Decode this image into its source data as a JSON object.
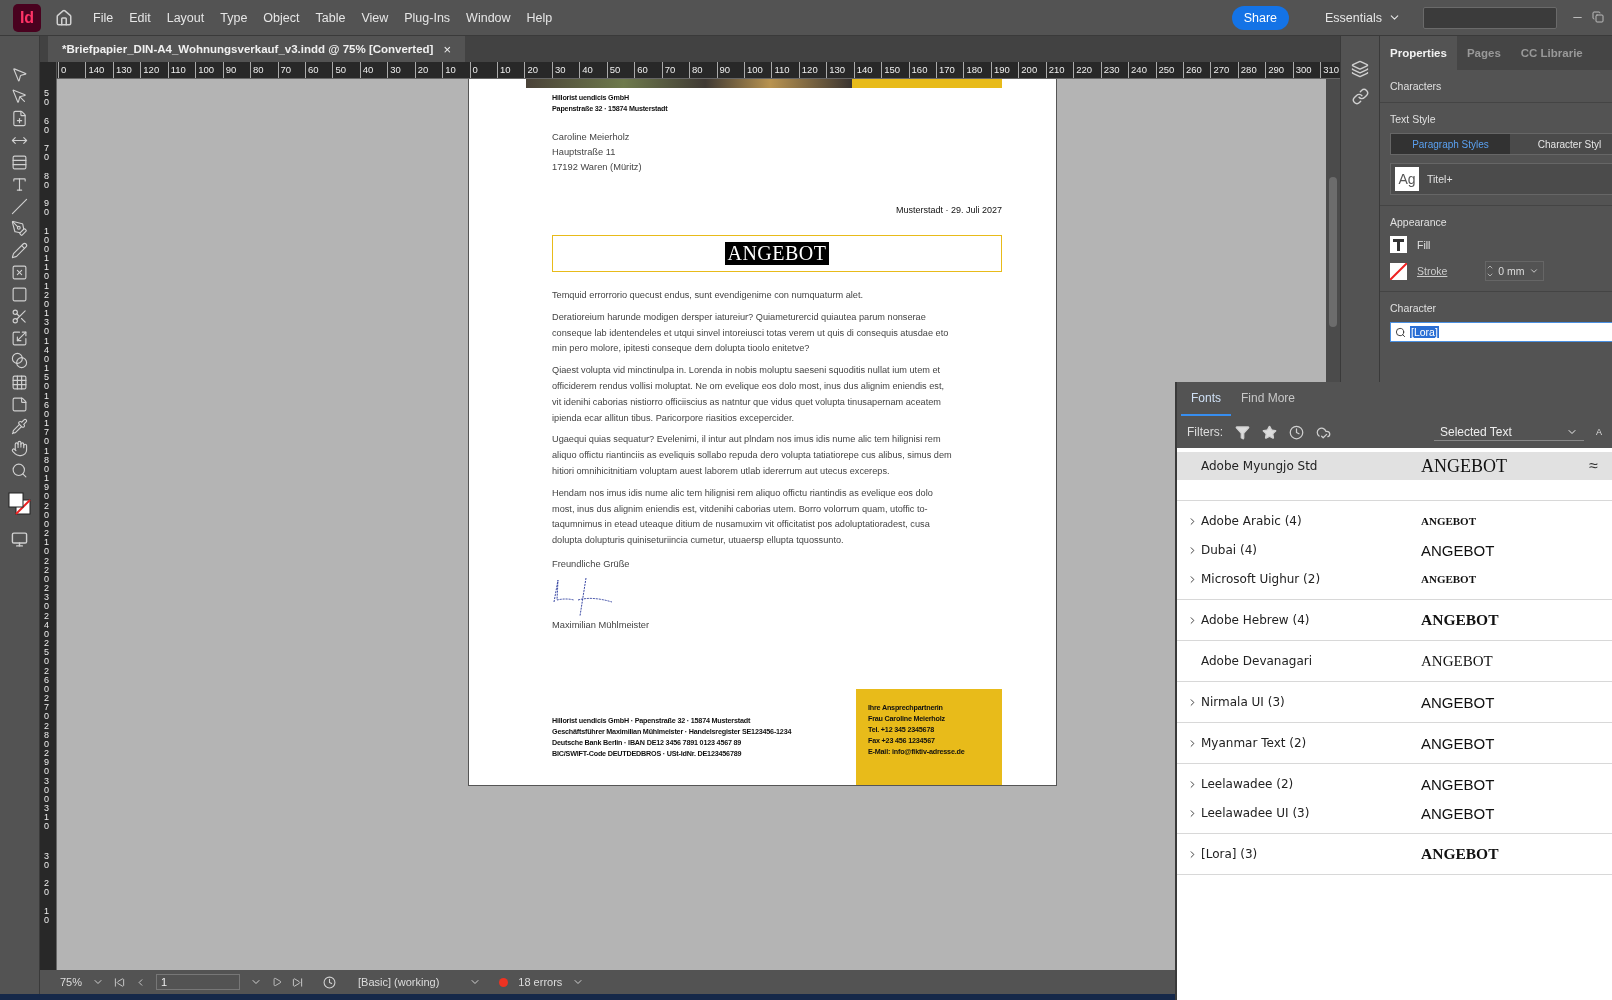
{
  "app": {
    "logo": "Id",
    "menu": [
      "File",
      "Edit",
      "Layout",
      "Type",
      "Object",
      "Table",
      "View",
      "Plug-Ins",
      "Window",
      "Help"
    ],
    "share": "Share",
    "workspace": "Essentials"
  },
  "document_tab": {
    "title": "*Briefpapier_DIN-A4_Wohnungsverkauf_v3.indd @ 75% [Converted]",
    "close": "×"
  },
  "ruler": {
    "horizontal": [
      "0",
      "140",
      "130",
      "120",
      "110",
      "100",
      "90",
      "80",
      "70",
      "60",
      "50",
      "40",
      "30",
      "20",
      "10",
      "0",
      "10",
      "20",
      "30",
      "40",
      "50",
      "60",
      "70",
      "80",
      "90",
      "100",
      "110",
      "120",
      "130",
      "140",
      "150",
      "160",
      "170",
      "180",
      "190",
      "200",
      "210",
      "220",
      "230",
      "240",
      "250",
      "260",
      "270",
      "280",
      "290",
      "300",
      "310"
    ],
    "vertical": [
      "50",
      "60",
      "70",
      "80",
      "90",
      "100",
      "110",
      "120",
      "130",
      "140",
      "150",
      "160",
      "170",
      "180",
      "190",
      "200",
      "210",
      "220",
      "230",
      "240",
      "250",
      "260",
      "270",
      "280",
      "290",
      "300",
      "310",
      "30",
      "20",
      "10"
    ]
  },
  "letter": {
    "sender": [
      "Hillorist uendicis GmbH",
      "Papenstraße 32 · 15874 Musterstadt"
    ],
    "recipient": [
      "Caroline Meierholz",
      "Hauptstraße 11",
      "17192 Waren (Müritz)"
    ],
    "date": "Musterstadt · 29. Juli 2027",
    "heading": {
      "text": "ANGEBOT",
      "selected": true
    },
    "paragraphs": [
      "Temquid errorrorio quecust endus, sunt evendigenime con numquaturm alet.",
      "Deratioreium harunde modigen dersper iatureiur? Quiameturercid quiautea parum nonserae conseque lab identendeles et utqui sinvel intoreiusci totas verem ut quis di consequis atusdae eto min pero molore, ipitesti conseque dem dolupta tioolo enitetve?",
      "Qiaest volupta vid minctinulpa in. Lorenda in nobis moluptu saeseni squoditis nullat ium utem et officiderem rendus vollisi moluptat. Ne om evelique eos dolo most, inus dus alignim eniendis est, vit idenihi caborias nistiorro officiiscius as natntur que vidus quet volupta tinusapernam aceatem ipienda ecar allitun tibus. Paricorpore riasitios excepercider.",
      "Ugaequi quias sequatur? Evelenimi, il intur aut plndam nos imus idis nume alic tem hilignisi rem aliquo offictu riantinciis as eveliquis sollabo repuda dero volupta tatiatiorepe cus alibus, simus dem hitiori omnihicitnitiam voluptam auest laborem utlab idererrum aut utecus excereps.",
      "Hendam nos imus idis nume alic tem hilignisi rem aliquo offictu riantindis as evelique eos dolo most, inus dus alignim eniendis est, vitdenihi caborias utem. Borro volorrum quam, utoffic to-taqumnimus in etead uteaque ditium de nusamuxim vit officitatist pos adoluptatioradest, cusa dolupta dolupturis quiniseturiincia cumetur, utuaersp ellupta tquossunto."
    ],
    "closing": "Freundliche Grüße",
    "signer": "Maximilian Mühlmeister",
    "footer": [
      "Hillorist uendicis GmbH · Papenstraße 32 · 15874 Musterstadt",
      "Geschäftsführer Maximilian Mühlmeister · Handelsregister SE123456-1234",
      "Deutsche Bank Berlin · IBAN DE12 3456 7891 0123 4567 89",
      "BIC/SWIFT-Code DEUTDEDBROS · USt-IdNr. DE123456789"
    ],
    "contact": [
      "Ihre Ansprechpartnerin",
      "Frau Caroline Meierholz",
      "Tel. +12 345 2345678",
      "Fax +23 456 1234567",
      "E-Mail: info@fiktiv-adresse.de"
    ]
  },
  "properties": {
    "tabs": [
      {
        "label": "Properties",
        "selected": true
      },
      {
        "label": "Pages",
        "selected": false
      },
      {
        "label": "CC Librarie",
        "selected": false
      }
    ],
    "section": "Characters",
    "text_style_title": "Text Style",
    "style_tabs": [
      {
        "label": "Paragraph Styles",
        "selected": true
      },
      {
        "label": "Character Styl",
        "selected": false
      }
    ],
    "style": {
      "swatch": "Ag",
      "name": "Titel+"
    },
    "appearance_title": "Appearance",
    "fill": "Fill",
    "stroke": "Stroke",
    "stroke_weight": "0 mm",
    "character_title": "Character",
    "font_field": "[Lora]"
  },
  "fonts_panel": {
    "tabs": [
      {
        "label": "Fonts",
        "selected": true
      },
      {
        "label": "Find More",
        "selected": false
      }
    ],
    "filters_label": "Filters:",
    "preview_source": "Selected Text",
    "size_glyph": "A",
    "groups": [
      [
        {
          "name": "Adobe Myungjo Std",
          "sample": "ANGEBOT",
          "kind": "serif-large",
          "expandable": false,
          "selected": true,
          "similar": "≈"
        }
      ],
      [
        {
          "name": "Adobe Arabic (4)",
          "sample": "ANGEBOT",
          "kind": "serif-small-bold",
          "expandable": true,
          "selected": false
        },
        {
          "name": "Dubai (4)",
          "sample": "ANGEBOT",
          "kind": "sans",
          "expandable": true,
          "selected": false
        },
        {
          "name": "Microsoft Uighur (2)",
          "sample": "ANGEBOT",
          "kind": "serif-small-bold",
          "expandable": true,
          "selected": false
        }
      ],
      [
        {
          "name": "Adobe Hebrew (4)",
          "sample": "ANGEBOT",
          "kind": "serif-bold",
          "expandable": true,
          "selected": false
        }
      ],
      [
        {
          "name": "Adobe Devanagari",
          "sample": "ANGEBOT",
          "kind": "serif",
          "expandable": false,
          "selected": false
        }
      ],
      [
        {
          "name": "Nirmala UI (3)",
          "sample": "ANGEBOT",
          "kind": "sans",
          "expandable": true,
          "selected": false
        }
      ],
      [
        {
          "name": "Myanmar Text (2)",
          "sample": "ANGEBOT",
          "kind": "sans",
          "expandable": true,
          "selected": false
        }
      ],
      [
        {
          "name": "Leelawadee (2)",
          "sample": "ANGEBOT",
          "kind": "sans",
          "expandable": true,
          "selected": false
        },
        {
          "name": "Leelawadee UI (3)",
          "sample": "ANGEBOT",
          "kind": "sans",
          "expandable": true,
          "selected": false
        }
      ],
      [
        {
          "name": "[Lora] (3)",
          "sample": "ANGEBOT",
          "kind": "serif-bold",
          "expandable": true,
          "selected": false
        }
      ]
    ]
  },
  "status_bar": {
    "zoom": "75%",
    "page": "1",
    "profile": "[Basic] (working)",
    "errors": "18 errors"
  }
}
